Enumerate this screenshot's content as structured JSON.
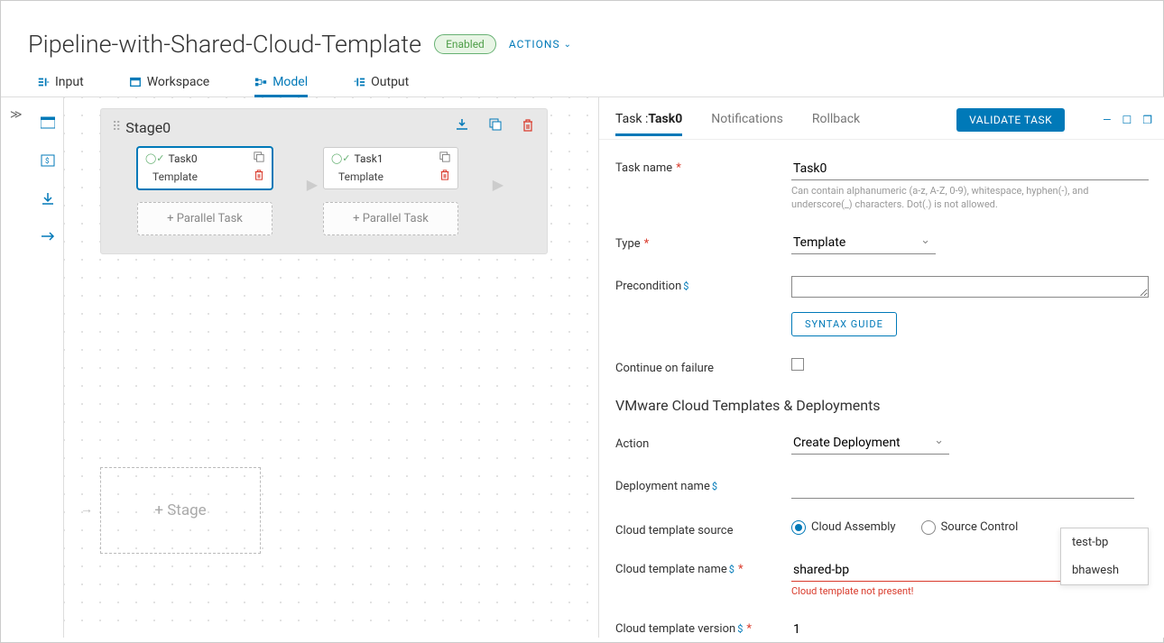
{
  "header": {
    "title": "Pipeline-with-Shared-Cloud-Template",
    "status": "Enabled",
    "actions_label": "ACTIONS"
  },
  "tabs": {
    "input": "Input",
    "workspace": "Workspace",
    "model": "Model",
    "output": "Output"
  },
  "canvas": {
    "stage": {
      "title": "Stage0",
      "task0": {
        "name": "Task0",
        "type": "Template"
      },
      "task1": {
        "name": "Task1",
        "type": "Template"
      },
      "parallel_label": "+ Parallel Task"
    },
    "add_stage": "+ Stage"
  },
  "panel": {
    "tabs": {
      "task": "Task :",
      "task_name": "Task0",
      "notifications": "Notifications",
      "rollback": "Rollback"
    },
    "validate_btn": "VALIDATE TASK",
    "form": {
      "task_name_label": "Task name",
      "task_name_val": "Task0",
      "task_name_hint": "Can contain alphanumeric (a-z, A-Z, 0-9), whitespace, hyphen(-), and underscore(_) characters. Dot(.) is not allowed.",
      "type_label": "Type",
      "type_val": "Template",
      "precond_label": "Precondition",
      "precond_val": "",
      "syntax_btn": "SYNTAX GUIDE",
      "continue_label": "Continue on failure",
      "section": "VMware Cloud Templates & Deployments",
      "action_label": "Action",
      "action_val": "Create Deployment",
      "deploy_name_label": "Deployment name",
      "deploy_name_val": "",
      "tpl_source_label": "Cloud template source",
      "radio1": "Cloud Assembly",
      "radio2": "Source Control",
      "tpl_name_label": "Cloud template name",
      "tpl_name_val": "shared-bp",
      "tpl_name_err": "Cloud template not present!",
      "tpl_ver_label": "Cloud template version",
      "tpl_ver_val": "1"
    },
    "dropdown": {
      "opt1": "test-bp",
      "opt2": "bhawesh"
    }
  }
}
